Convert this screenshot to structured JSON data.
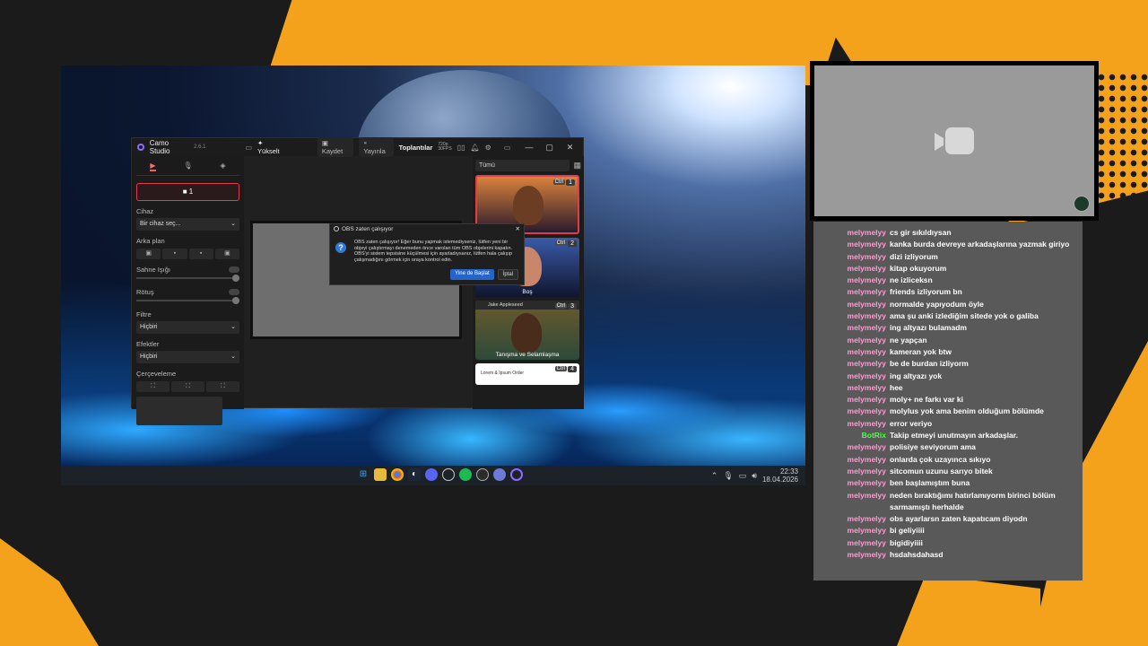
{
  "colors": {
    "accent_orange": "#f4a21c",
    "chat_bg": "#595959",
    "user_pink": "#ff9bd0",
    "bot_green": "#4cff46",
    "camo_red": "#e03c4a"
  },
  "camo": {
    "app_name": "Camo Studio",
    "version": "2.6.1",
    "upgrade": "Yükselt",
    "record": "Kaydet",
    "publish": "Yayınla",
    "meetings": "Toplantılar",
    "resolution": "720p\n30FPS",
    "camera_button": "1",
    "device_label": "Cihaz",
    "device_select": "Bir cihaz seç...",
    "background_label": "Arka plan",
    "stage_light_label": "Sahne Işığı",
    "retouch_label": "Rötuş",
    "filter_label": "Filtre",
    "filter_value": "Hiçbiri",
    "effects_label": "Efektler",
    "effects_value": "Hiçbiri",
    "framing_label": "Çerçeveleme",
    "right_filter": "Tümü",
    "cards": [
      {
        "num": "1",
        "ctrl": "Ctrl",
        "caption": "...ugo"
      },
      {
        "num": "2",
        "ctrl": "Ctrl",
        "caption": "Boş"
      },
      {
        "num": "3",
        "ctrl": "Ctrl",
        "caption": "Tanışma ve Selamlaşma",
        "head": "Jake Appleseed"
      },
      {
        "num": "4",
        "ctrl": "Ctrl",
        "caption": "Lorem & Ipsum Order"
      }
    ]
  },
  "dialog": {
    "title": "OBS zaten çalışıyor",
    "message": "OBS zaten çalışıyor! Eğer bunu yapmak istemediyseniz, lütfen yeni bir objeyi çalıştırmayı denemeden önce varolan tüm OBS objelerini kapatın. OBS'yi sistem tepsisine küçülmesi için ayarladıysanız, lütfen hala çalışıp çalışmadığını görmek için oraya kontrol edin.",
    "primary_button": "Yine de Başlat",
    "cancel_button": "İptal"
  },
  "taskbar": {
    "time": "22:33",
    "date": "18.04.2026"
  },
  "chat": [
    {
      "user": "melymelyy",
      "text": "cs gir sıkıldıysan"
    },
    {
      "user": "melymelyy",
      "text": "kanka burda devreye arkadaşlarına yazmak giriyo"
    },
    {
      "user": "melymelyy",
      "text": "dizi izliyorum"
    },
    {
      "user": "melymelyy",
      "text": "kitap okuyorum"
    },
    {
      "user": "melymelyy",
      "text": "ne izliceksn"
    },
    {
      "user": "melymelyy",
      "text": "friends izliyorum bn"
    },
    {
      "user": "melymelyy",
      "text": "normalde yapıyodum öyle"
    },
    {
      "user": "melymelyy",
      "text": "ama şu anki izlediğim sitede yok o galiba"
    },
    {
      "user": "melymelyy",
      "text": "ing altyazı bulamadm"
    },
    {
      "user": "melymelyy",
      "text": "ne yapçan"
    },
    {
      "user": "melymelyy",
      "text": "kameran yok btw"
    },
    {
      "user": "melymelyy",
      "text": "be de burdan izliyorm"
    },
    {
      "user": "melymelyy",
      "text": "ing altyazı yok"
    },
    {
      "user": "melymelyy",
      "text": "hee"
    },
    {
      "user": "melymelyy",
      "text": "moly+ ne farkı var ki"
    },
    {
      "user": "melymelyy",
      "text": "molylus yok ama benim olduğum bölümde"
    },
    {
      "user": "melymelyy",
      "text": "error veriyo"
    },
    {
      "user": "BotRix",
      "text": "Takip etmeyi unutmayın arkadaşlar.",
      "bot": true
    },
    {
      "user": "melymelyy",
      "text": "polisiye seviyorum ama"
    },
    {
      "user": "melymelyy",
      "text": "onlarda çok uzayınca sıkıyo"
    },
    {
      "user": "melymelyy",
      "text": "sitcomun uzunu sarıyo bitek"
    },
    {
      "user": "melymelyy",
      "text": "ben başlamıştım buna"
    },
    {
      "user": "melymelyy",
      "text": "neden bıraktığımı hatırlamıyorm birinci bölüm sarmamıştı herhalde"
    },
    {
      "user": "melymelyy",
      "text": "obs ayarlarsn zaten kapatıcam diyodn"
    },
    {
      "user": "melymelyy",
      "text": "bi geliyiiii"
    },
    {
      "user": "melymelyy",
      "text": "bigidiyiiii"
    },
    {
      "user": "melymelyy",
      "text": "hsdahsdahasd"
    }
  ]
}
